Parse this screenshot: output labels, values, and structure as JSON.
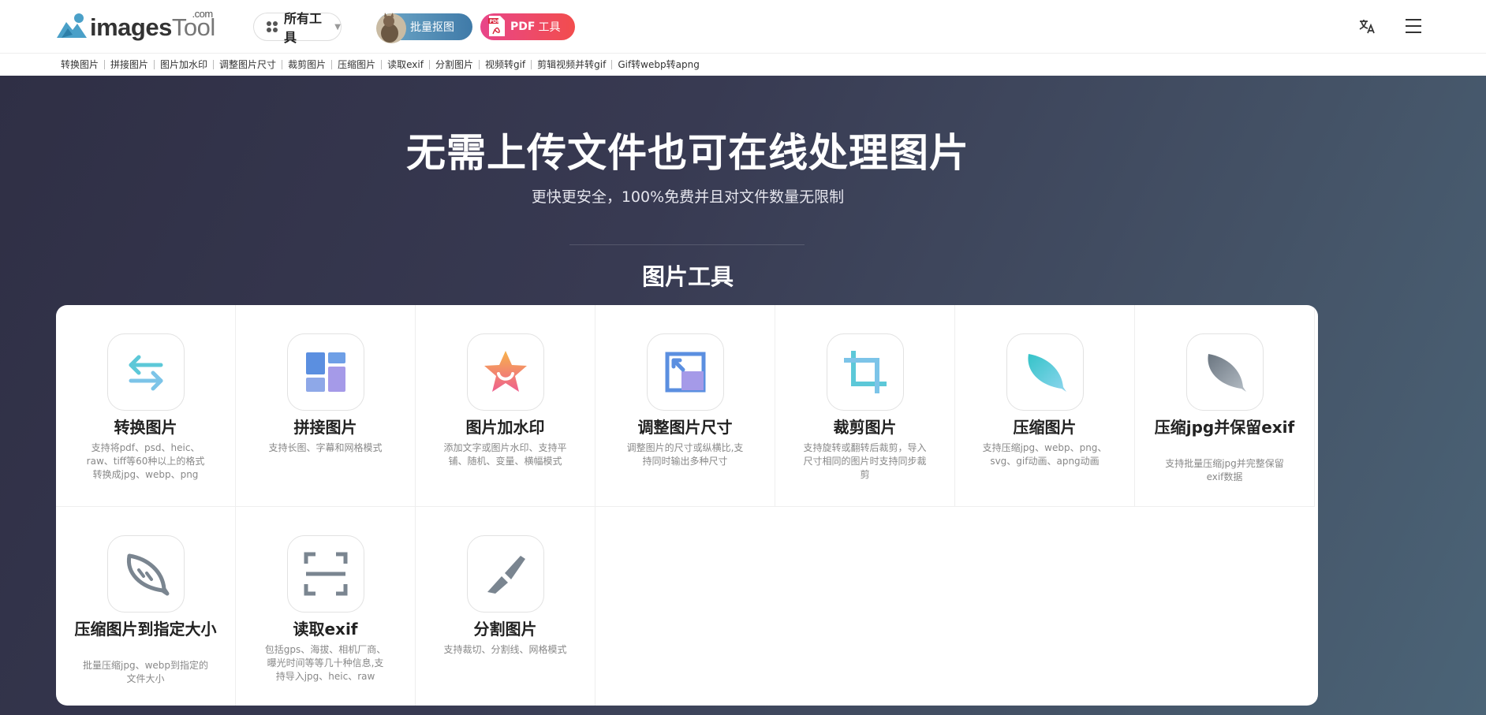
{
  "header": {
    "logo": {
      "main": "images",
      "accent": "Tool",
      "suffix": ".com"
    },
    "all_tools_label": "所有工具",
    "batch_button_label": "批量抠图",
    "pdf_button": {
      "bold": "PDF",
      "label": "工具"
    },
    "icons": [
      "translate-icon",
      "menu-icon"
    ]
  },
  "subnav": [
    "转换图片",
    "拼接图片",
    "图片加水印",
    "调整图片尺寸",
    "裁剪图片",
    "压缩图片",
    "读取exif",
    "分割图片",
    "视频转gif",
    "剪辑视频并转gif",
    "Gif转webp转apng"
  ],
  "hero": {
    "title": "无需上传文件也可在线处理图片",
    "subtitle": "更快更安全，100%免费并且对文件数量无限制"
  },
  "section_title": "图片工具",
  "tools": [
    {
      "name": "转换图片",
      "desc": "支持将pdf、psd、heic、raw、tiff等60种以上的格式转换成jpg、webp、png",
      "icon": "convert-arrows-icon"
    },
    {
      "name": "拼接图片",
      "desc": "支持长图、字幕和网格模式",
      "icon": "collage-icon"
    },
    {
      "name": "图片加水印",
      "desc": "添加文字或图片水印、支持平铺、随机、变量、横幅模式",
      "icon": "watermark-star-icon"
    },
    {
      "name": "调整图片尺寸",
      "desc": "调整图片的尺寸或纵横比,支持同时输出多种尺寸",
      "icon": "resize-icon"
    },
    {
      "name": "裁剪图片",
      "desc": "支持旋转或翻转后裁剪，导入尺寸相同的图片时支持同步裁剪",
      "icon": "crop-icon"
    },
    {
      "name": "压缩图片",
      "desc": "支持压缩jpg、webp、png、svg、gif动画、apng动画",
      "icon": "feather-icon"
    },
    {
      "name": "压缩jpg并保留exif",
      "desc": "支持批量压缩jpg并完整保留exif数据",
      "icon": "feather-gray-icon"
    },
    {
      "name": "压缩图片到指定大小",
      "desc": "批量压缩jpg、webp到指定的文件大小",
      "icon": "feather-outline-icon"
    },
    {
      "name": "读取exif",
      "desc": "包括gps、海拔、相机厂商、曝光时间等等几十种信息,支持导入jpg、heic、raw",
      "icon": "scan-frame-icon"
    },
    {
      "name": "分割图片",
      "desc": "支持裁切、分割线、网格模式",
      "icon": "knife-icon"
    }
  ],
  "colors": {
    "hero_start": "#2f2f45",
    "hero_end": "#4b6477",
    "batch_button": "#4a86b2",
    "pdf_button": "#ef4a6a",
    "icon_teal": "#5cc8d8",
    "icon_blue": "#5b8fe0",
    "icon_purple": "#a59ae8",
    "icon_gray": "#7a8590"
  }
}
